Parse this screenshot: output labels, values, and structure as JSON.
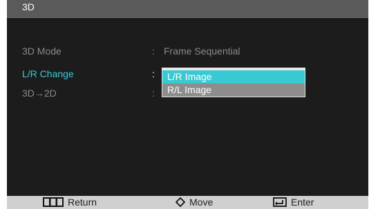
{
  "title": "3D",
  "menu": [
    {
      "label": "3D Mode",
      "sep": ":",
      "value": "Frame Sequential"
    },
    {
      "label": "L/R Change",
      "sep": ":",
      "value": ""
    },
    {
      "label": "3D→2D",
      "sep": ":",
      "value": ""
    }
  ],
  "dropdown": {
    "options": [
      "L/R Image",
      "R/L Image"
    ],
    "selected": "L/R Image"
  },
  "footer": {
    "return_label": "Return",
    "move_label": "Move",
    "enter_label": "Enter"
  },
  "icons": {
    "return": "menu-return-icon",
    "move": "diamond-arrows-icon",
    "enter": "enter-icon"
  },
  "colors": {
    "accent": "#3ac9d8",
    "background": "#1c1c1c",
    "titlebar": "#5a5a5a",
    "footer": "#d0d0d0"
  }
}
